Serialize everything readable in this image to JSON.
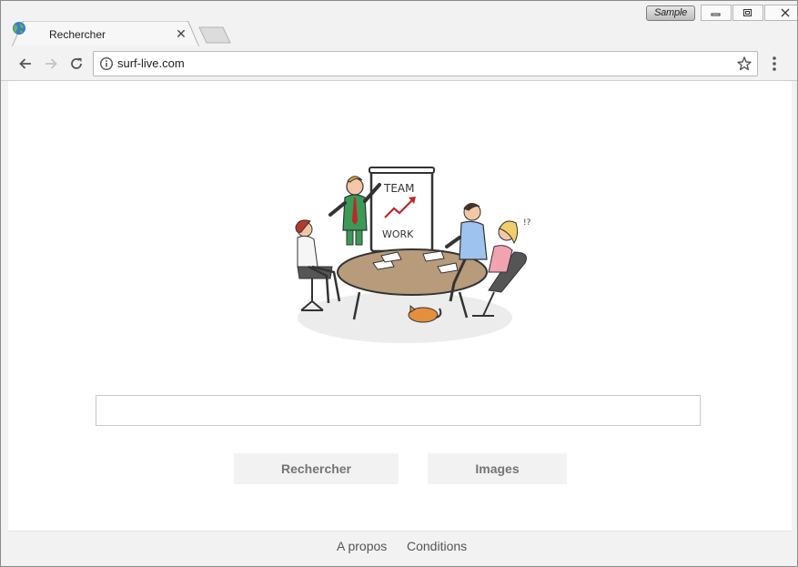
{
  "window": {
    "badge": "Sample",
    "minimize_icon": "minimize-icon",
    "maximize_icon": "restore-icon",
    "close_icon": "close-icon"
  },
  "tab": {
    "title": "Rechercher",
    "favicon": "globe-icon",
    "close_glyph": "✕"
  },
  "toolbar": {
    "back_icon": "arrow-left-icon",
    "forward_icon": "arrow-right-icon",
    "reload_icon": "reload-icon",
    "site_info_icon": "info-icon",
    "url": "surf-live.com",
    "bookmark_icon": "star-icon",
    "menu_icon": "more-vert-icon"
  },
  "page": {
    "illustration_text": [
      "TEAM",
      "WORK"
    ],
    "search": {
      "value": "",
      "placeholder": ""
    },
    "buttons": {
      "search": "Rechercher",
      "images": "Images"
    }
  },
  "footer": {
    "links": [
      "A propos",
      "Conditions"
    ]
  },
  "colors": {
    "chrome_bg": "#f2f2f2",
    "button_bg": "#f2f2f2",
    "button_text": "#757575",
    "footer_text": "#555555",
    "table_color": "#b79b7a",
    "chart_arrow": "#c0262c"
  }
}
